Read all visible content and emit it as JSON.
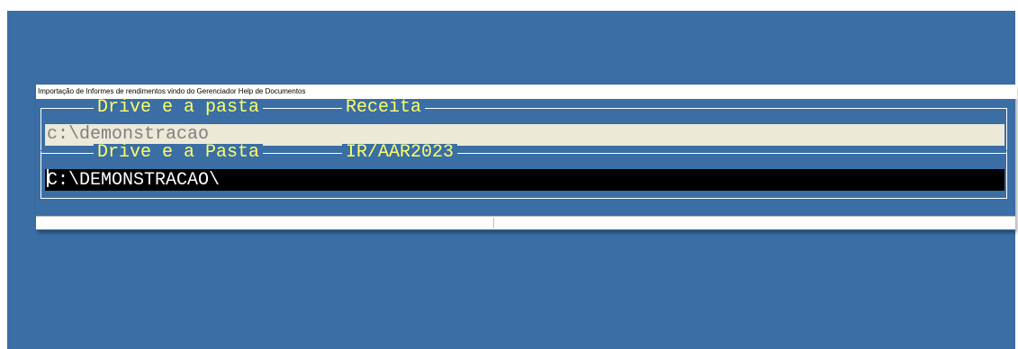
{
  "window": {
    "title": "Importação de Informes de rendimentos vindo do Gerenciador Help de Documentos"
  },
  "section_receita": {
    "legend_left": "Drive e a pasta",
    "legend_right": "Receita",
    "path_value": "c:\\demonstracao"
  },
  "section_ir": {
    "legend_left": "Drive e a Pasta",
    "legend_right": "IR/AAR2023",
    "path_value": "C:\\DEMONSTRACAO\\"
  },
  "statusbar": {
    "pane1": "",
    "pane2": ""
  },
  "colors": {
    "desktop": "#3a6ea5",
    "legend_text": "#ffff66",
    "field_receita_bg": "#ece9d8",
    "field_ir_bg": "#000000"
  }
}
